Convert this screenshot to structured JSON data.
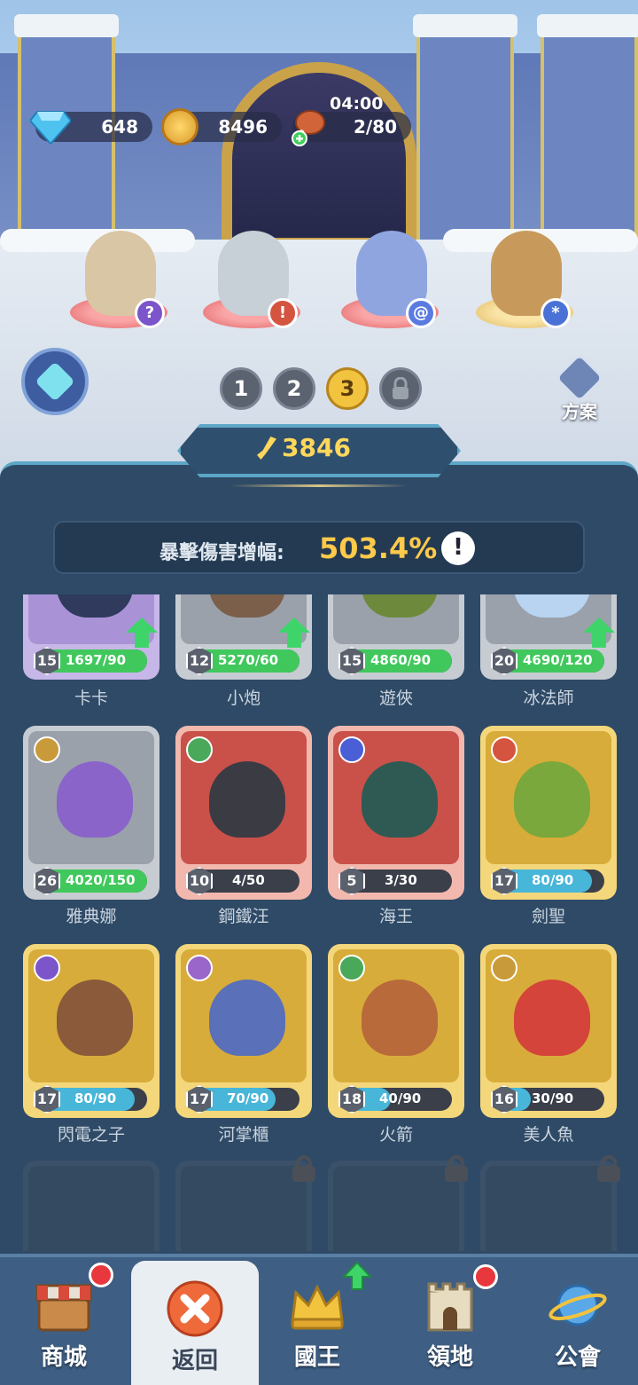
{
  "resources": {
    "gems": "648",
    "coins": "8496",
    "stamina": "2/80",
    "stamina_timer": "04:00",
    "gem_icon": "diamond-icon",
    "coin_icon": "coin-icon",
    "stamina_icon": "meat-icon"
  },
  "lineup": [
    {
      "badge": "?",
      "badge_color": "#7b55c9",
      "ring": "red",
      "hero_color": "#d9c6a4"
    },
    {
      "badge": "!",
      "badge_color": "#d4543f",
      "ring": "red",
      "hero_color": "#c7d0d6"
    },
    {
      "badge": "@",
      "badge_color": "#5a7be0",
      "ring": "red",
      "hero_color": "#8fa5e0"
    },
    {
      "badge": "*",
      "badge_color": "#4a72d6",
      "ring": "gold",
      "hero_color": "#c79a5c"
    }
  ],
  "formation_slots": [
    "1",
    "2",
    "3",
    ""
  ],
  "active_slot": 2,
  "plan_label": "方案",
  "power": "3846",
  "bonus": {
    "label": "暴擊傷害增幅:",
    "value": "503.4%",
    "info": "!"
  },
  "heroes": [
    {
      "name": "卡卡",
      "level": "15",
      "progress": "1697/90",
      "rarity": "purple",
      "fill": 1.0,
      "fill_color": "#41c85d",
      "upgrade": true
    },
    {
      "name": "小炮",
      "level": "12",
      "progress": "5270/60",
      "rarity": "grey",
      "fill": 1.0,
      "fill_color": "#41c85d",
      "upgrade": true
    },
    {
      "name": "遊俠",
      "level": "15",
      "progress": "4860/90",
      "rarity": "grey",
      "fill": 1.0,
      "fill_color": "#41c85d",
      "upgrade": false
    },
    {
      "name": "冰法師",
      "level": "20",
      "progress": "4690/120",
      "rarity": "grey",
      "fill": 1.0,
      "fill_color": "#41c85d",
      "upgrade": true
    },
    {
      "name": "雅典娜",
      "level": "26",
      "progress": "4020/150",
      "rarity": "grey",
      "fill": 1.0,
      "fill_color": "#41c85d",
      "upgrade": false,
      "class_color": "#c89a3a"
    },
    {
      "name": "鋼鐵汪",
      "level": "10",
      "progress": "4/50",
      "rarity": "red",
      "fill": 0.08,
      "fill_color": "#48b6d8",
      "upgrade": false,
      "class_color": "#4aa85a"
    },
    {
      "name": "海王",
      "level": "5",
      "progress": "3/30",
      "rarity": "red",
      "fill": 0.1,
      "fill_color": "#48b6d8",
      "upgrade": false,
      "class_color": "#4a5fd6"
    },
    {
      "name": "劍聖",
      "level": "17",
      "progress": "80/90",
      "rarity": "gold",
      "fill": 0.89,
      "fill_color": "#48b6d8",
      "upgrade": false,
      "class_color": "#d4543f"
    },
    {
      "name": "閃電之子",
      "level": "17",
      "progress": "80/90",
      "rarity": "gold",
      "fill": 0.89,
      "fill_color": "#48b6d8",
      "upgrade": false,
      "class_color": "#7b55c9"
    },
    {
      "name": "河掌櫃",
      "level": "17",
      "progress": "70/90",
      "rarity": "gold",
      "fill": 0.78,
      "fill_color": "#48b6d8",
      "upgrade": false,
      "class_color": "#9a66c9"
    },
    {
      "name": "火箭",
      "level": "18",
      "progress": "40/90",
      "rarity": "gold",
      "fill": 0.44,
      "fill_color": "#48b6d8",
      "upgrade": false,
      "class_color": "#4aa85a"
    },
    {
      "name": "美人魚",
      "level": "16",
      "progress": "30/90",
      "rarity": "gold",
      "fill": 0.33,
      "fill_color": "#48b6d8",
      "upgrade": false,
      "class_color": "#c89a3a"
    }
  ],
  "nav": [
    {
      "label": "商城",
      "icon": "shop-icon",
      "dot": true
    },
    {
      "label": "返回",
      "icon": "close-icon",
      "dot": false,
      "active": true
    },
    {
      "label": "國王",
      "icon": "crown-icon",
      "dot": false,
      "arrow": true
    },
    {
      "label": "領地",
      "icon": "castle-icon",
      "dot": true
    },
    {
      "label": "公會",
      "icon": "planet-icon",
      "dot": false
    }
  ]
}
